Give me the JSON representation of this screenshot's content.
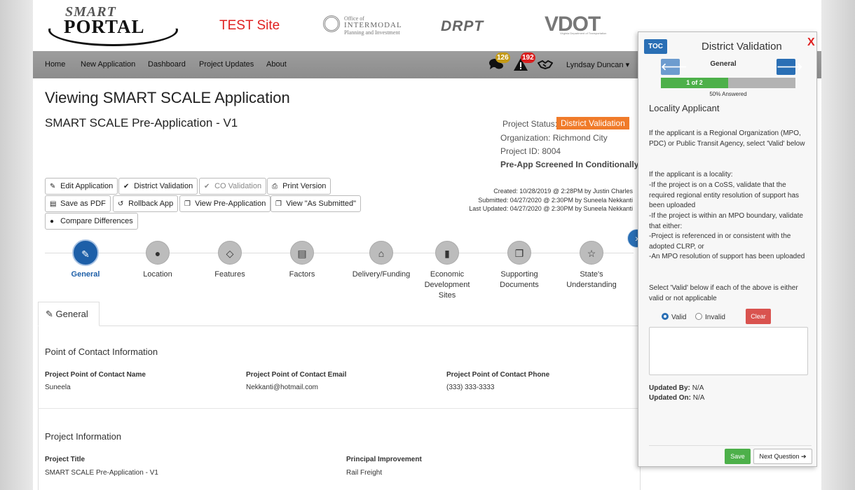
{
  "header": {
    "logo_line1": "SMART",
    "logo_line2": "PORTAL",
    "test_site": "TEST Site",
    "oim_line1": "Office of",
    "oim_line2": "INTERMODAL",
    "oim_line3": "Planning and Investment",
    "drpt": "DRPT",
    "vdot": "VDOT",
    "vdot_sub": "Virginia Department of Transportation"
  },
  "nav": {
    "items": [
      "Home",
      "New Application",
      "Dashboard",
      "Project Updates",
      "About"
    ],
    "messages_count": "126",
    "alerts_count": "192",
    "user": "Lyndsay Duncan ▾"
  },
  "main": {
    "title": "Viewing SMART SCALE Application",
    "subtitle": "SMART SCALE Pre-Application - V1",
    "status_label": "Project Status:",
    "status_value": "District Validation",
    "organization": "Organization: Richmond City",
    "project_id": "Project ID: 8004",
    "screened": "Pre-App Screened In Conditionally",
    "created": "Created: 10/28/2019 @ 2:28PM by Justin Charles",
    "submitted": "Submitted: 04/27/2020 @ 2:30PM by Suneela Nekkanti",
    "last_updated": "Last Updated: 04/27/2020 @ 2:30PM by Suneela Nekkanti"
  },
  "buttons": {
    "edit": "Edit Application",
    "district": "District Validation",
    "co": "CO Validation",
    "print": "Print Version",
    "pdf": "Save as PDF",
    "rollback": "Rollback App",
    "view_pre": "View Pre-Application",
    "view_submitted": "View \"As Submitted\"",
    "compare": "Compare Differences"
  },
  "steps": [
    {
      "label": "General",
      "icon": "edit-icon"
    },
    {
      "label": "Location",
      "icon": "globe-icon"
    },
    {
      "label": "Features",
      "icon": "diamond-icon"
    },
    {
      "label": "Factors",
      "icon": "list-icon"
    },
    {
      "label": "Delivery/Funding",
      "icon": "bank-icon"
    },
    {
      "label": "Economic Development Sites",
      "icon": "building-icon"
    },
    {
      "label": "Supporting Documents",
      "icon": "documents-icon"
    },
    {
      "label": "State's Understanding",
      "icon": "star-icon"
    }
  ],
  "tab": {
    "label": "General"
  },
  "contact": {
    "heading": "Point of Contact Information",
    "name_label": "Project Point of Contact Name",
    "name_value": "Suneela",
    "email_label": "Project Point of Contact Email",
    "email_value": "Nekkanti@hotmail.com",
    "phone_label": "Project Point of Contact Phone",
    "phone_value": "(333) 333-3333"
  },
  "project": {
    "heading": "Project Information",
    "title_label": "Project Title",
    "title_value": "SMART SCALE Pre-Application - V1",
    "improvement_label": "Principal Improvement",
    "improvement_value": "Rail Freight"
  },
  "panel": {
    "toc": "TOC",
    "title": "District Validation",
    "close": "X",
    "section": "General",
    "progress_text": "1 of 2",
    "progress_fraction": 0.5,
    "answered": "50% Answered",
    "question_title": "Locality Applicant",
    "q_para1": "If the applicant is a Regional Organization (MPO, PDC) or Public Transit Agency, select 'Valid' below",
    "q_para2_lines": [
      "If the applicant is a locality:",
      "-If the project is on a CoSS, validate that the required regional entity resolution of support has been uploaded",
      "-If the project is within an MPO boundary, validate that either:",
      "-Project is referenced in or consistent with the adopted CLRP, or",
      "-An MPO resolution of support has been uploaded"
    ],
    "q_para3": "Select 'Valid' below if each of the above is either valid or not applicable",
    "valid": "Valid",
    "invalid": "Invalid",
    "clear": "Clear",
    "updated_by_label": "Updated By:",
    "updated_by_value": "N/A",
    "updated_on_label": "Updated On:",
    "updated_on_value": "N/A",
    "save": "Save",
    "next": "Next Question ➔"
  },
  "colors": {
    "accent": "#2a6fb5",
    "status": "#f07b2a",
    "success": "#4db04a",
    "danger": "#d9534f"
  }
}
